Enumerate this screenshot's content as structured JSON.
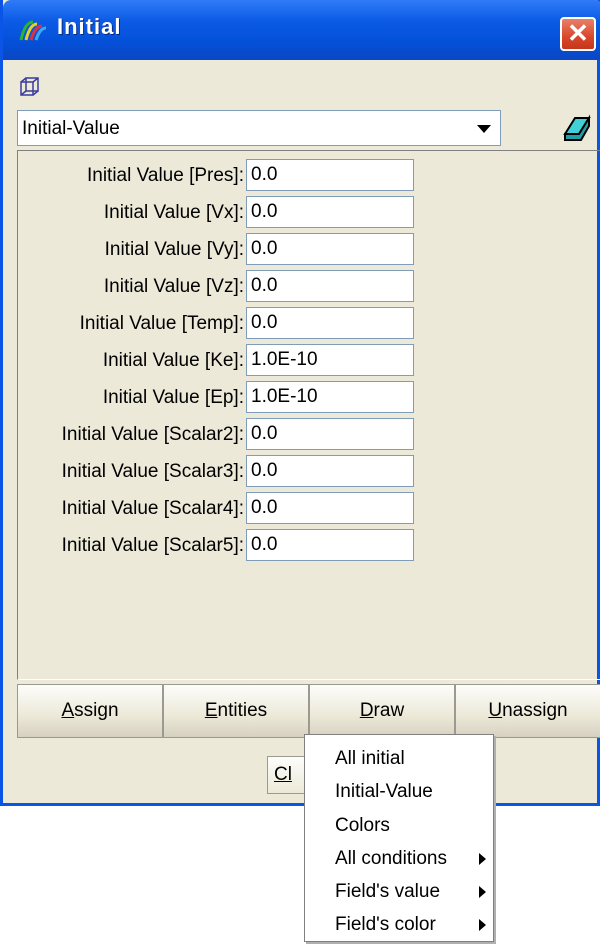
{
  "window": {
    "title": "Initial"
  },
  "condition_select": {
    "value": "Initial-Value"
  },
  "fields": [
    {
      "label": "Initial Value [Pres]:",
      "value": "0.0"
    },
    {
      "label": "Initial Value [Vx]:",
      "value": "0.0"
    },
    {
      "label": "Initial Value [Vy]:",
      "value": "0.0"
    },
    {
      "label": "Initial Value [Vz]:",
      "value": "0.0"
    },
    {
      "label": "Initial Value [Temp]:",
      "value": "0.0"
    },
    {
      "label": "Initial Value [Ke]:",
      "value": "1.0E-10"
    },
    {
      "label": "Initial Value [Ep]:",
      "value": "1.0E-10"
    },
    {
      "label": "Initial Value [Scalar2]:",
      "value": "0.0"
    },
    {
      "label": "Initial Value [Scalar3]:",
      "value": "0.0"
    },
    {
      "label": "Initial Value [Scalar4]:",
      "value": "0.0"
    },
    {
      "label": "Initial Value [Scalar5]:",
      "value": "0.0"
    }
  ],
  "buttons": {
    "assign": {
      "accel": "A",
      "rest": "ssign"
    },
    "entities": {
      "accel": "E",
      "rest": "ntities"
    },
    "draw": {
      "accel": "D",
      "rest": "raw"
    },
    "unassign": {
      "accel": "U",
      "rest": "nassign"
    },
    "close": "Cl"
  },
  "draw_menu": {
    "items": [
      "All initial",
      "Initial-Value",
      "Colors",
      "All conditions",
      "Field's value",
      "Field's color"
    ],
    "submenu_items": [
      "All conditions",
      "Field's value",
      "Field's color"
    ]
  },
  "colors": {
    "titlebar": "#0450d8",
    "window_bg": "#ece9d8",
    "close_red": "#d9472b"
  },
  "icons": [
    "multicolor-app-icon",
    "close-icon",
    "cube-wireframe-icon",
    "dropdown-arrow-icon",
    "eraser-icon",
    "submenu-arrow-icon"
  ]
}
